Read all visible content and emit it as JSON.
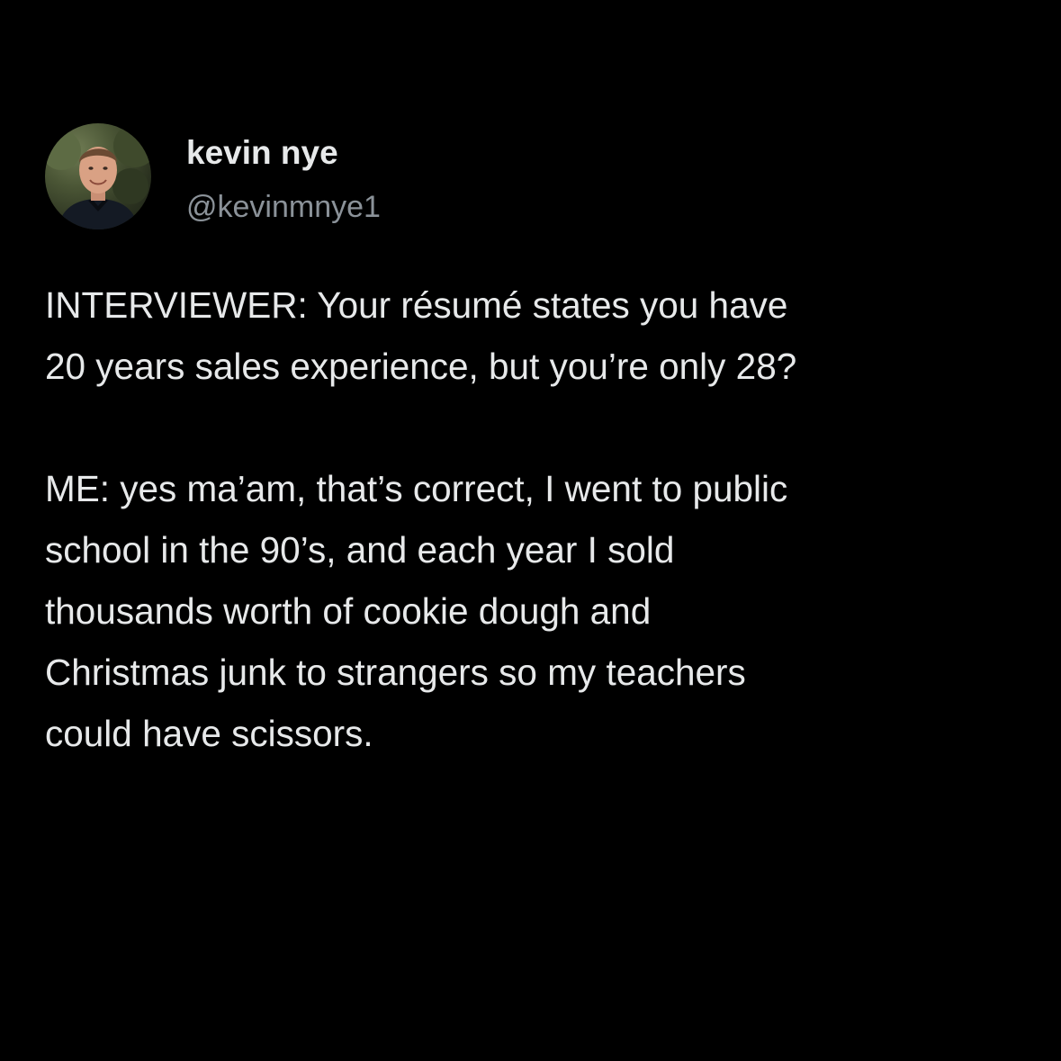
{
  "tweet": {
    "author": {
      "display_name": "kevin nye",
      "handle": "@kevinmnye1",
      "avatar_icon": "profile-photo"
    },
    "paragraphs": [
      "INTERVIEWER: Your résumé states you have\n20 years sales experience, but you’re only 28?",
      "ME: yes ma’am, that’s correct, I went to public\nschool in the 90’s, and each year I sold\nthousands worth of cookie dough and\nChristmas junk to strangers so my teachers\ncould have scissors."
    ]
  },
  "colors": {
    "background": "#000000",
    "text_primary": "#e7e9ea",
    "text_secondary": "#8b9299"
  }
}
